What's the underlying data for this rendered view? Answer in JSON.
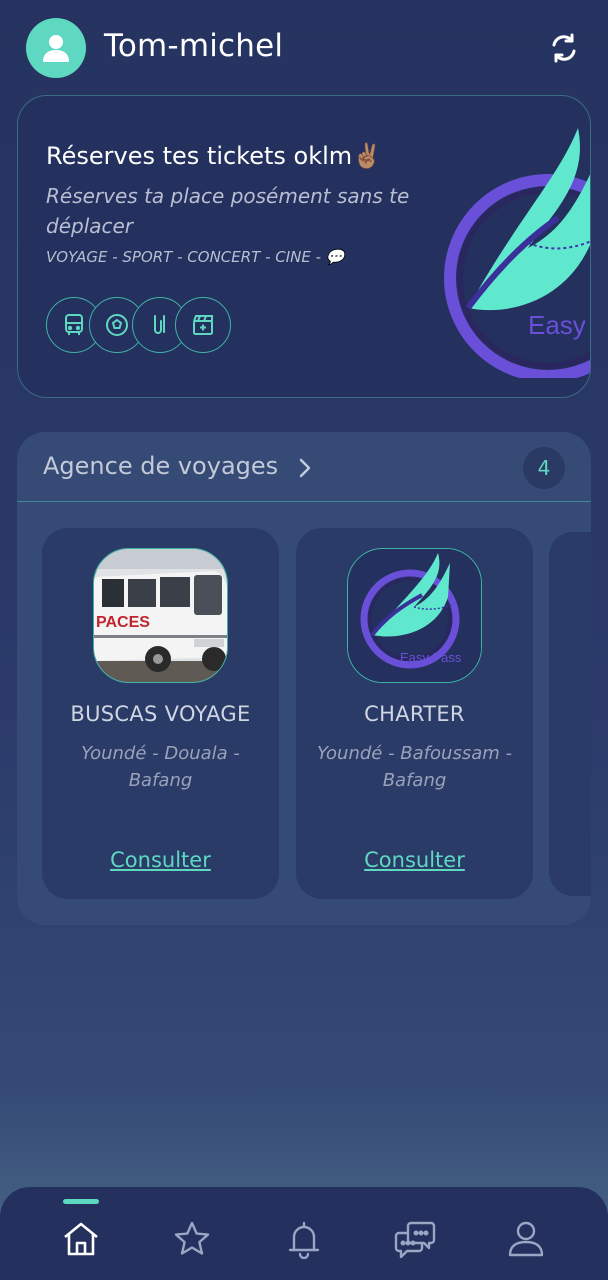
{
  "header": {
    "username": "Tom-michel",
    "avatar_icon": "user-icon",
    "sync_icon": "refresh-icon"
  },
  "promo": {
    "title": "Réserves tes tickets oklm✌🏽",
    "subtitle": "Réserves ta place posément sans te déplacer",
    "categories": "VOYAGE - SPORT - CONCERT - CINE - 💬",
    "icons": [
      "bus-icon",
      "ball-icon",
      "guitar-icon",
      "clapperboard-icon"
    ],
    "logo_text": "Easy Pass"
  },
  "agencies": {
    "title": "Agence de voyages",
    "count": "4",
    "items": [
      {
        "name": "BUSCAS VOYAGE",
        "route": "Youndé - Douala - Bafang",
        "action": "Consulter",
        "bus_text": "PACES"
      },
      {
        "name": "CHARTER",
        "route": "Youndé - Bafoussam - Bafang",
        "action": "Consulter",
        "logo_text": "Easy Pass"
      }
    ]
  },
  "nav": {
    "items": [
      "home-icon",
      "star-icon",
      "bell-icon",
      "chat-icon",
      "profile-icon"
    ],
    "active": "home"
  },
  "colors": {
    "accent": "#5ed8c0",
    "background": "#263360",
    "card": "#24305d",
    "panel": "#354a74",
    "logo_purple": "#7b5cf0"
  }
}
